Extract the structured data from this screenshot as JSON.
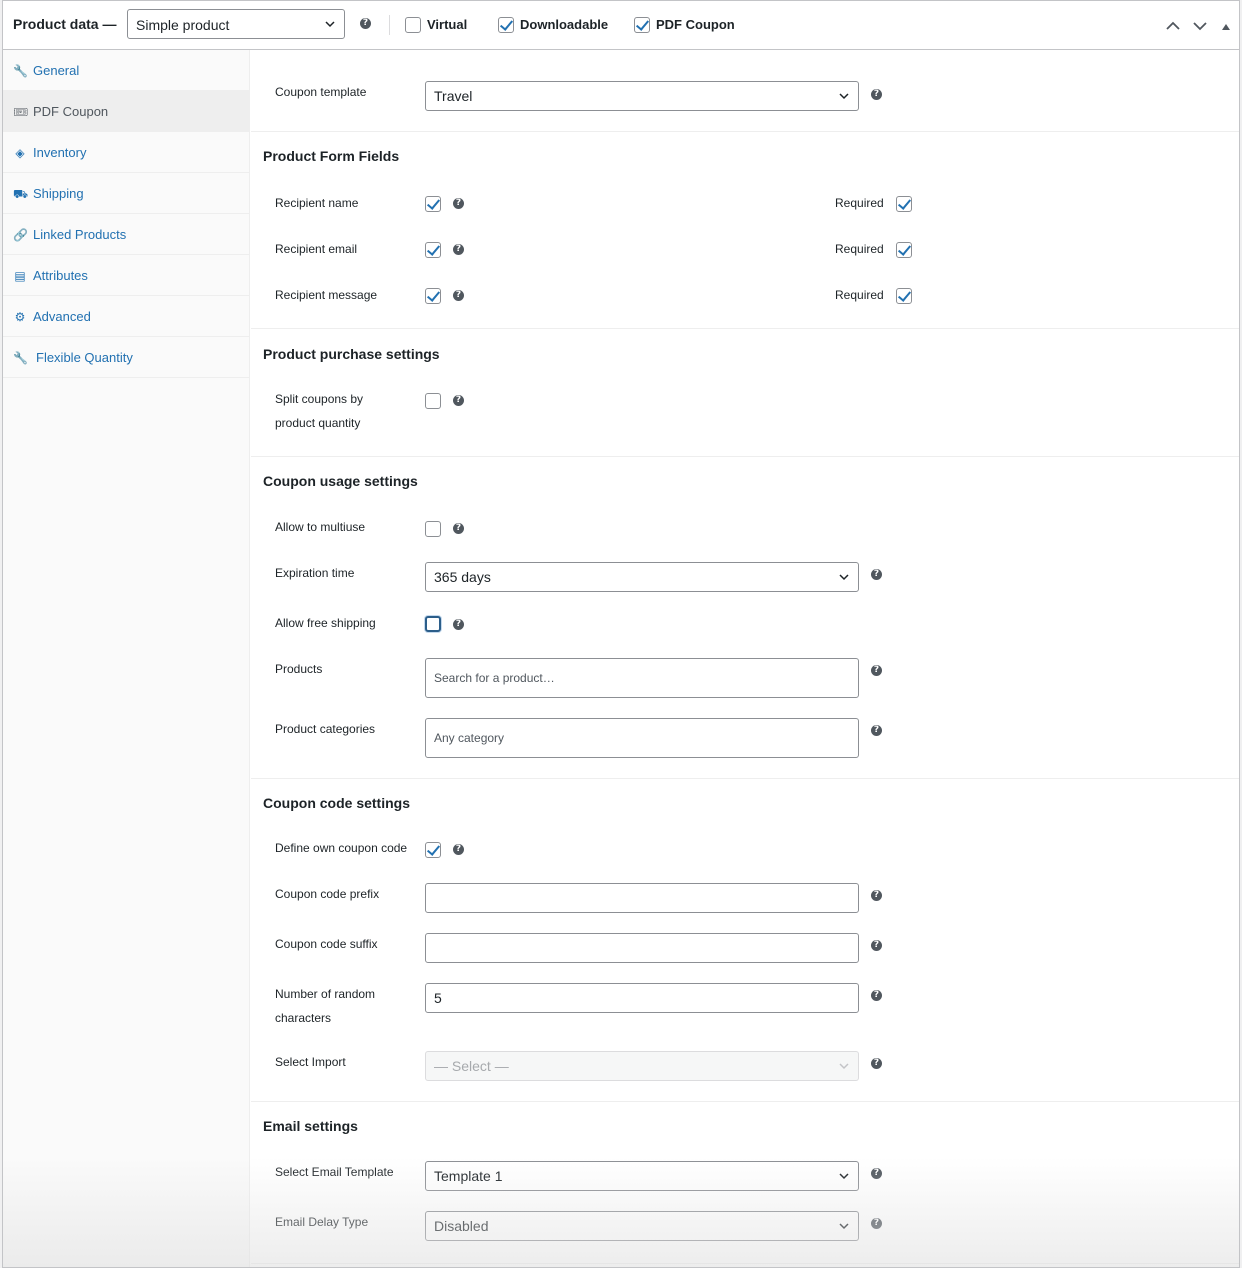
{
  "header": {
    "title": "Product data —",
    "product_type": "Simple product",
    "virtual_label": "Virtual",
    "virtual_checked": false,
    "downloadable_label": "Downloadable",
    "downloadable_checked": true,
    "pdf_coupon_label": "PDF Coupon",
    "pdf_coupon_checked": true,
    "help_icon": "?"
  },
  "sidebar": {
    "items": [
      {
        "label": "General",
        "icon": "wrench-icon",
        "glyph": "🔧",
        "active": false
      },
      {
        "label": "PDF Coupon",
        "icon": "ticket-icon",
        "glyph": "🎟",
        "active": true
      },
      {
        "label": "Inventory",
        "icon": "tag-icon",
        "glyph": "◈",
        "active": false
      },
      {
        "label": "Shipping",
        "icon": "truck-icon",
        "glyph": "⛟",
        "active": false
      },
      {
        "label": "Linked Products",
        "icon": "link-icon",
        "glyph": "🔗",
        "active": false
      },
      {
        "label": "Attributes",
        "icon": "list-icon",
        "glyph": "▤",
        "active": false
      },
      {
        "label": "Advanced",
        "icon": "gear-icon",
        "glyph": "⚙",
        "active": false
      },
      {
        "label": "Flexible Quantity",
        "icon": "wrench-icon",
        "glyph": "🔧",
        "active": false
      }
    ]
  },
  "coupon_template": {
    "label": "Coupon template",
    "value": "Travel"
  },
  "form_fields": {
    "title": "Product Form Fields",
    "required_label": "Required",
    "rows": [
      {
        "label": "Recipient name",
        "checked": true,
        "required": true
      },
      {
        "label": "Recipient email",
        "checked": true,
        "required": true
      },
      {
        "label": "Recipient message",
        "checked": true,
        "required": true
      }
    ]
  },
  "purchase": {
    "title": "Product purchase settings",
    "split_label_1": "Split coupons by",
    "split_label_2": "product quantity",
    "split_checked": false
  },
  "usage": {
    "title": "Coupon usage settings",
    "multiuse_label": "Allow to multiuse",
    "multiuse_checked": false,
    "expiration_label": "Expiration time",
    "expiration_value": "365 days",
    "free_shipping_label": "Allow free shipping",
    "free_shipping_checked": false,
    "products_label": "Products",
    "products_placeholder": "Search for a product…",
    "categories_label": "Product categories",
    "categories_placeholder": "Any category"
  },
  "code": {
    "title": "Coupon code settings",
    "own_code_label": "Define own coupon code",
    "own_code_checked": true,
    "prefix_label": "Coupon code prefix",
    "prefix_value": "",
    "suffix_label": "Coupon code suffix",
    "suffix_value": "",
    "random_label_1": "Number of random",
    "random_label_2": "characters",
    "random_value": "5",
    "import_label": "Select Import",
    "import_value": "— Select —"
  },
  "email": {
    "title": "Email settings",
    "template_label": "Select Email Template",
    "template_value": "Template 1",
    "delay_label": "Email Delay Type",
    "delay_value": "Disabled"
  }
}
